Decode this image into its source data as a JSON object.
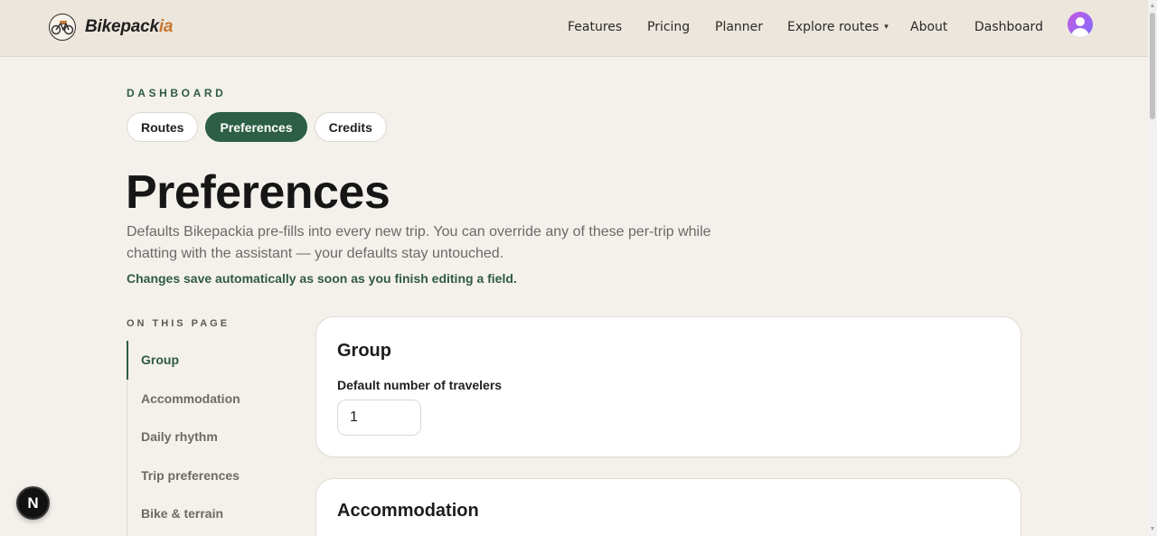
{
  "brand": {
    "name_main": "Bikepack",
    "name_accent": "ia"
  },
  "nav": {
    "items": [
      "Features",
      "Pricing",
      "Planner",
      "Explore routes",
      "About",
      "Dashboard"
    ],
    "caret": "▾"
  },
  "page": {
    "eyebrow": "DASHBOARD",
    "tabs": [
      {
        "label": "Routes",
        "active": false
      },
      {
        "label": "Preferences",
        "active": true
      },
      {
        "label": "Credits",
        "active": false
      }
    ],
    "title": "Preferences",
    "intro": "Defaults Bikepackia pre-fills into every new trip. You can override any of these per-trip while chatting with the assistant — your defaults stay untouched.",
    "autosave_note": "Changes save automatically as soon as you finish editing a field."
  },
  "toc": {
    "title": "ON THIS PAGE",
    "items": [
      "Group",
      "Accommodation",
      "Daily rhythm",
      "Trip preferences",
      "Bike & terrain"
    ],
    "active_index": 0
  },
  "sections": {
    "group": {
      "title": "Group",
      "field_label": "Default number of travelers",
      "field_value": "1"
    },
    "accommodation": {
      "title": "Accommodation"
    }
  },
  "badge": {
    "label": "N"
  },
  "colors": {
    "accent_green": "#2d5e46",
    "brand_orange": "#c9772f",
    "background": "#f4f1ec",
    "header_bg": "#ece6dc"
  },
  "icons": [
    "bike-logo-icon",
    "chevron-down-icon",
    "user-avatar-icon"
  ]
}
